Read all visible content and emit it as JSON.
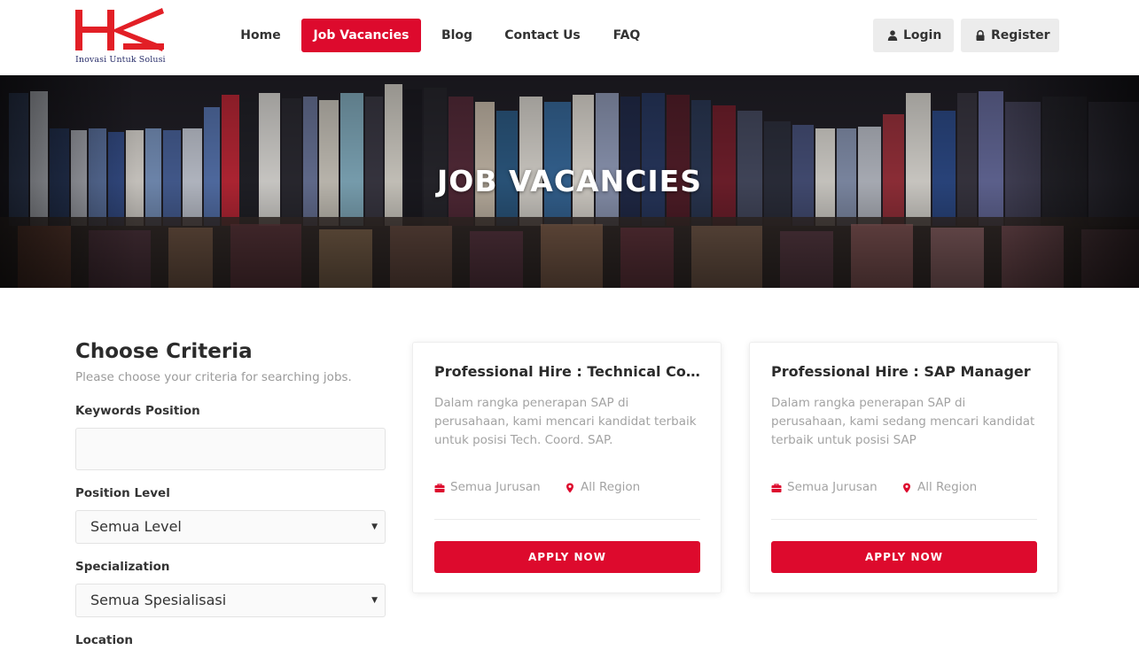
{
  "brand": {
    "logo_text": "HK",
    "tagline": "Inovasi Untuk Solusi",
    "accent_color": "#dd0a2d"
  },
  "nav": {
    "items": [
      {
        "label": "Home",
        "active": false
      },
      {
        "label": "Job Vacancies",
        "active": true
      },
      {
        "label": "Blog",
        "active": false
      },
      {
        "label": "Contact Us",
        "active": false
      },
      {
        "label": "FAQ",
        "active": false
      }
    ],
    "login_label": "Login",
    "login_icon": "user-icon",
    "register_label": "Register",
    "register_icon": "lock-icon"
  },
  "hero": {
    "title": "JOB VACANCIES"
  },
  "criteria": {
    "title": "Choose Criteria",
    "subtitle": "Please choose your criteria for searching jobs.",
    "keywords_label": "Keywords Position",
    "keywords_value": "",
    "level_label": "Position Level",
    "level_value": "Semua Level",
    "specialization_label": "Specialization",
    "specialization_value": "Semua Spesialisasi",
    "location_label": "Location"
  },
  "jobs": [
    {
      "title": "Professional Hire : Technical Coor...",
      "description": "Dalam rangka penerapan SAP di perusahaan, kami mencari kandidat terbaik untuk posisi Tech. Coord. SAP.",
      "major": "Semua Jurusan",
      "major_icon": "briefcase-icon",
      "region": "All Region",
      "region_icon": "map-pin-icon",
      "apply_label": "APPLY NOW"
    },
    {
      "title": "Professional Hire : SAP Manager",
      "description": "Dalam rangka penerapan SAP di perusahaan, kami sedang mencari kandidat terbaik untuk posisi SAP",
      "major": "Semua Jurusan",
      "major_icon": "briefcase-icon",
      "region": "All Region",
      "region_icon": "map-pin-icon",
      "apply_label": "APPLY NOW"
    }
  ]
}
